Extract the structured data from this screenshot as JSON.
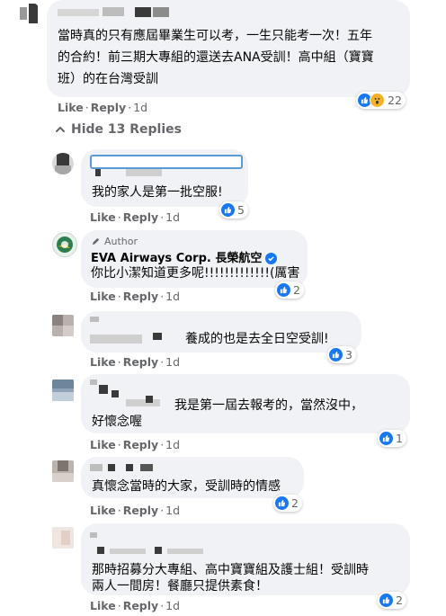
{
  "comments": [
    {
      "text_lines": [
        "當時真的只有應屆畢業生可以考，一生只能考一次！五年",
        "的合約！前三期大專組的還送去ANA受訓！高中組（寶寶",
        "班）的在台灣受訓"
      ],
      "like_label": "Like",
      "reply_label": "Reply",
      "time": "1d",
      "reactions_count": "22"
    }
  ],
  "hide_replies_label": "Hide 13 Replies",
  "replies": [
    {
      "text": "我的家人是第一批空服!",
      "like_label": "Like",
      "reply_label": "Reply",
      "time": "1d",
      "reactions_count": "5"
    },
    {
      "author_badge": "Author",
      "name": "EVA Airways Corp. 長榮航空",
      "text": "你比小潔知道更多呢!!!!!!!!!!!!!(厲害",
      "like_label": "Like",
      "reply_label": "Reply",
      "time": "1d",
      "reactions_count": "2"
    },
    {
      "text": "養成的也是去全日空受訓!",
      "like_label": "Like",
      "reply_label": "Reply",
      "time": "1d",
      "reactions_count": "3"
    },
    {
      "text_lines": [
        "我是第一屆去報考的，當然沒中，",
        "好懷念喔"
      ],
      "like_label": "Like",
      "reply_label": "Reply",
      "time": "1d",
      "reactions_count": "1"
    },
    {
      "text": "真懷念當時的大家，受訓時的情感",
      "like_label": "Like",
      "reply_label": "Reply",
      "time": "1d",
      "reactions_count": "2"
    },
    {
      "text_lines": [
        "那時招募分大專組、高中寶寶組及護士組！受訓時",
        "兩人一間房！餐廳只提供素食！"
      ],
      "like_label": "Like",
      "reply_label": "Reply",
      "time": "1d",
      "reactions_count": "2"
    }
  ]
}
